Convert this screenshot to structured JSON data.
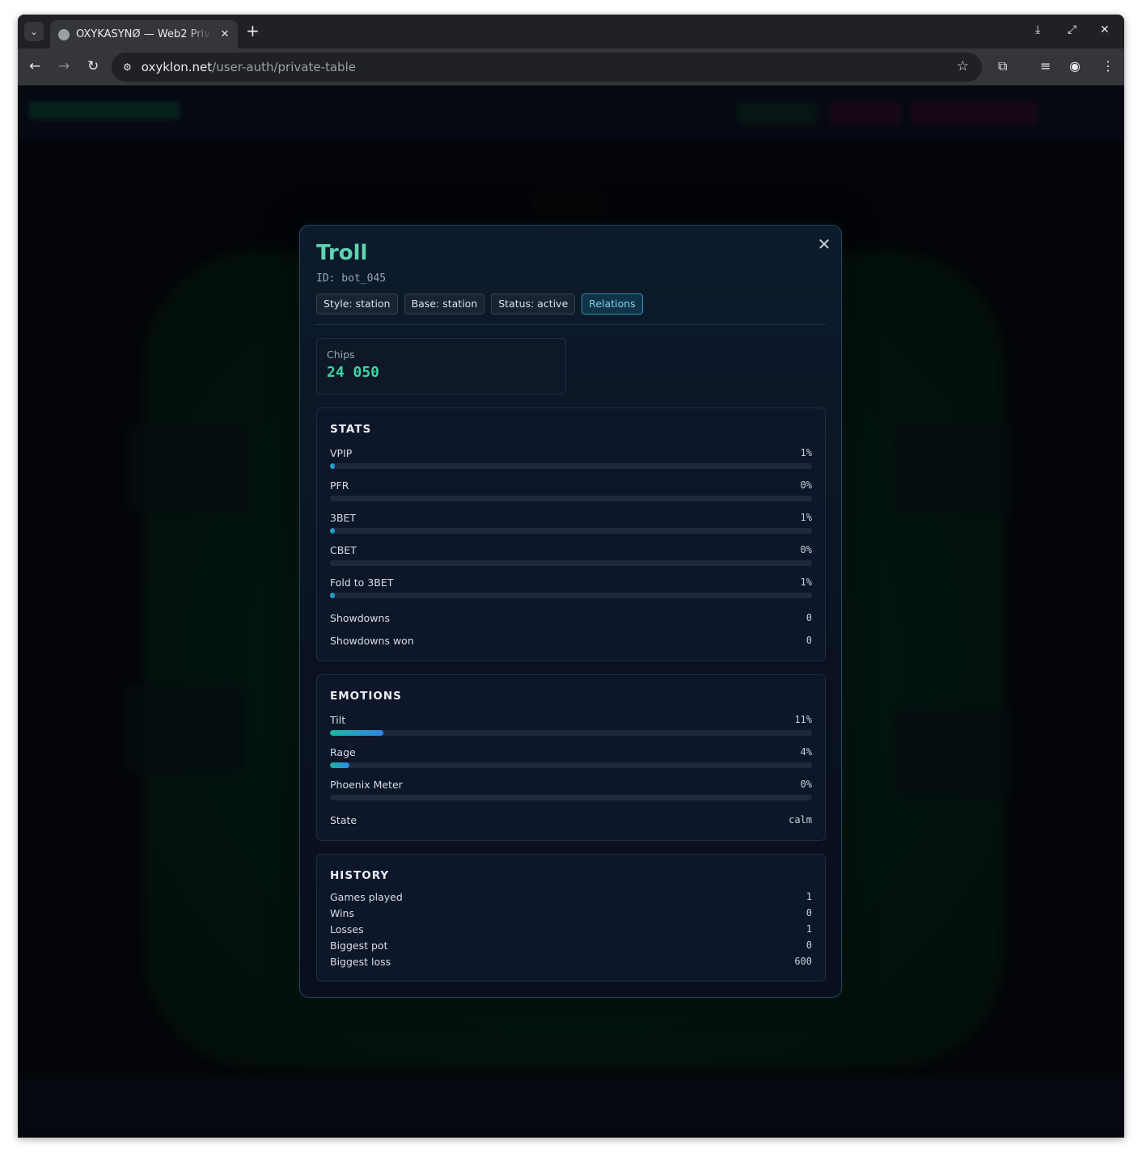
{
  "browser": {
    "tab_title": "OXYKASYNØ — Web2 Priv",
    "url_host": "oxyklon.net",
    "url_path": "/user-auth/private-table"
  },
  "modal": {
    "name": "Troll",
    "id_text": "ID: bot_045",
    "tags": [
      "Style: station",
      "Base: station",
      "Status: active",
      "Relations"
    ],
    "chips_label": "Chips",
    "chips_value": "24 050",
    "stats": {
      "title": "STATS",
      "items": [
        {
          "label": "VPIP",
          "value": "1%",
          "fraction": 0.01
        },
        {
          "label": "PFR",
          "value": "0%",
          "fraction": 0.0
        },
        {
          "label": "3BET",
          "value": "1%",
          "fraction": 0.01
        },
        {
          "label": "CBET",
          "value": "0%",
          "fraction": 0.0
        },
        {
          "label": "Fold to 3BET",
          "value": "1%",
          "fraction": 0.01
        }
      ],
      "plain": [
        {
          "label": "Showdowns",
          "value": "0"
        },
        {
          "label": "Showdowns won",
          "value": "0"
        }
      ]
    },
    "emotions": {
      "title": "EMOTIONS",
      "items": [
        {
          "label": "Tilt",
          "value": "11%",
          "fraction": 0.11
        },
        {
          "label": "Rage",
          "value": "4%",
          "fraction": 0.04
        },
        {
          "label": "Phoenix Meter",
          "value": "0%",
          "fraction": 0.0
        }
      ],
      "state_label": "State",
      "state_value": "calm"
    },
    "history": {
      "title": "HISTORY",
      "items": [
        {
          "label": "Games played",
          "value": "1"
        },
        {
          "label": "Wins",
          "value": "0"
        },
        {
          "label": "Losses",
          "value": "1"
        },
        {
          "label": "Biggest pot",
          "value": "0"
        },
        {
          "label": "Biggest loss",
          "value": "600"
        }
      ]
    }
  }
}
